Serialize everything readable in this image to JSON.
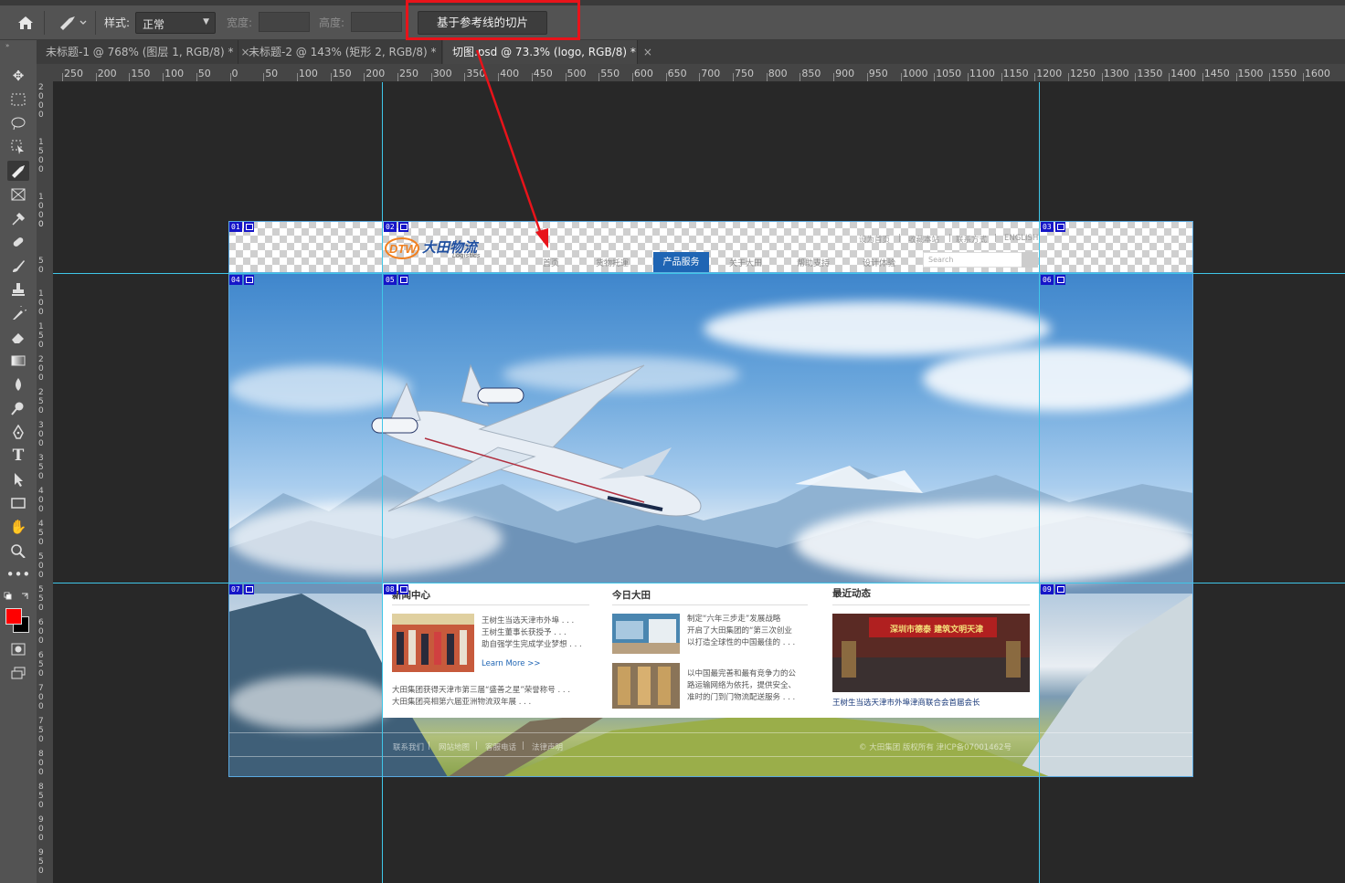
{
  "optionsbar": {
    "style_label": "样式:",
    "style_value": "正常",
    "width_label": "宽度:",
    "height_label": "高度:",
    "slices_from_guides_button": "基于参考线的切片"
  },
  "tabs": [
    {
      "label": "未标题-1 @ 768% (图层 1, RGB/8) *",
      "close": "×"
    },
    {
      "label": "未标题-2 @ 143% (矩形 2, RGB/8) *",
      "close": "×"
    },
    {
      "label": "切图.psd @ 73.3% (logo, RGB/8) *",
      "close": "×"
    }
  ],
  "ruler": {
    "h_labels": [
      "250",
      "200",
      "150",
      "100",
      "50",
      "0",
      "50",
      "100",
      "150",
      "200",
      "250",
      "300",
      "350",
      "400",
      "450",
      "500",
      "550",
      "600",
      "650",
      "700",
      "750",
      "800",
      "850",
      "900",
      "950",
      "1000",
      "1050",
      "1100",
      "1150",
      "1200",
      "1250",
      "1300",
      "1350",
      "1400",
      "1450",
      "1500",
      "1550",
      "1600"
    ]
  },
  "slices": [
    "01",
    "02",
    "03",
    "04",
    "05",
    "06",
    "07",
    "08",
    "09"
  ],
  "website": {
    "logo_text": "大田物流",
    "logo_sub": "Logistics",
    "top_links": [
      "设为首页",
      "收藏本站",
      "联系方式",
      "ENGLISH"
    ],
    "top_seps": [
      "|",
      "|",
      "|"
    ],
    "nav": [
      "首页",
      "货物托運",
      "产品服务",
      "关于大田",
      "帮助支持",
      "设计体验"
    ],
    "search_placeholder": "Search",
    "news": {
      "title": "新闻中心",
      "items": [
        "王树生当选天津市外埠 . . .",
        "王树生董事长获授予 . . .",
        "助自强学生完成学业梦想 . . ."
      ],
      "learn_more": "Learn More >>",
      "links": [
        "大田集团获得天津市第三届“盛善之星”荣誉称号 . . .",
        "大田集团亮相第六届亚洲物流双年展 . . ."
      ]
    },
    "today": {
      "title": "今日大田",
      "p1": [
        "制定“六年三步走”发展战略",
        "开启了大田集团的“第三次创业",
        "以打造全球性的中国最佳的 . . ."
      ],
      "p2": [
        "以中国最完善和最有竞争力的公",
        "路运输网络为依托，提供安全、",
        "准时的门到门物流配送服务 . . ."
      ]
    },
    "recent": {
      "title": "最近动态",
      "banner": "深圳市德泰 建筑文明天津",
      "link": "王树生当选天津市外埠津商联合会首届会长"
    },
    "footer": [
      "联系我们",
      "网站地图",
      "客服电话",
      "法律声明"
    ],
    "footer_seps": [
      "|",
      "|",
      "|"
    ],
    "copyright": "© 大田集团 版权所有 津ICP备07001462号"
  }
}
